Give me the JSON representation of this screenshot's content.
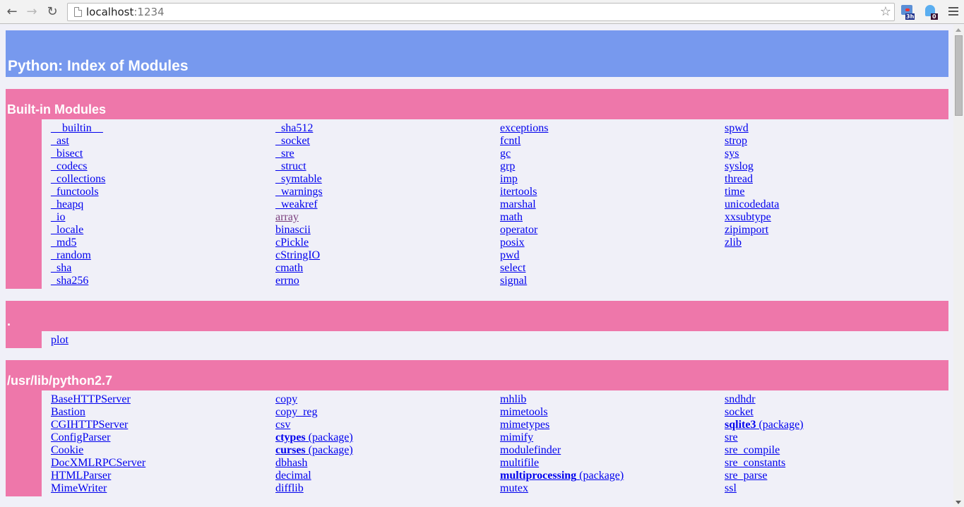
{
  "browser": {
    "url_host": "localhost",
    "url_port": ":1234",
    "extensions": [
      {
        "name": "calendar-extension",
        "badge": "3h"
      },
      {
        "name": "ghostery-extension",
        "badge": "0"
      }
    ]
  },
  "page": {
    "title": "Python: Index of Modules",
    "sections": [
      {
        "heading": "Built-in Modules",
        "columns": [
          [
            {
              "name": "__builtin__"
            },
            {
              "name": "_ast"
            },
            {
              "name": "_bisect"
            },
            {
              "name": "_codecs"
            },
            {
              "name": "_collections"
            },
            {
              "name": "_functools"
            },
            {
              "name": "_heapq"
            },
            {
              "name": "_io"
            },
            {
              "name": "_locale"
            },
            {
              "name": "_md5"
            },
            {
              "name": "_random"
            },
            {
              "name": "_sha"
            },
            {
              "name": "_sha256"
            }
          ],
          [
            {
              "name": "_sha512"
            },
            {
              "name": "_socket"
            },
            {
              "name": "_sre"
            },
            {
              "name": "_struct"
            },
            {
              "name": "_symtable"
            },
            {
              "name": "_warnings"
            },
            {
              "name": "_weakref"
            },
            {
              "name": "array",
              "visited": true
            },
            {
              "name": "binascii"
            },
            {
              "name": "cPickle"
            },
            {
              "name": "cStringIO"
            },
            {
              "name": "cmath"
            },
            {
              "name": "errno"
            }
          ],
          [
            {
              "name": "exceptions"
            },
            {
              "name": "fcntl"
            },
            {
              "name": "gc"
            },
            {
              "name": "grp"
            },
            {
              "name": "imp"
            },
            {
              "name": "itertools"
            },
            {
              "name": "marshal"
            },
            {
              "name": "math"
            },
            {
              "name": "operator"
            },
            {
              "name": "posix"
            },
            {
              "name": "pwd"
            },
            {
              "name": "select"
            },
            {
              "name": "signal"
            }
          ],
          [
            {
              "name": "spwd"
            },
            {
              "name": "strop"
            },
            {
              "name": "sys"
            },
            {
              "name": "syslog"
            },
            {
              "name": "thread"
            },
            {
              "name": "time"
            },
            {
              "name": "unicodedata"
            },
            {
              "name": "xxsubtype"
            },
            {
              "name": "zipimport"
            },
            {
              "name": "zlib"
            }
          ]
        ]
      },
      {
        "heading": ".",
        "columns": [
          [
            {
              "name": "plot"
            }
          ],
          [],
          [],
          []
        ]
      },
      {
        "heading": "/usr/lib/python2.7",
        "columns": [
          [
            {
              "name": "BaseHTTPServer"
            },
            {
              "name": "Bastion"
            },
            {
              "name": "CGIHTTPServer"
            },
            {
              "name": "ConfigParser"
            },
            {
              "name": "Cookie"
            },
            {
              "name": "DocXMLRPCServer"
            },
            {
              "name": "HTMLParser"
            },
            {
              "name": "MimeWriter"
            }
          ],
          [
            {
              "name": "copy"
            },
            {
              "name": "copy_reg"
            },
            {
              "name": "csv"
            },
            {
              "name": "ctypes",
              "package_label": " (package)"
            },
            {
              "name": "curses",
              "package_label": " (package)"
            },
            {
              "name": "dbhash"
            },
            {
              "name": "decimal"
            },
            {
              "name": "difflib"
            }
          ],
          [
            {
              "name": "mhlib"
            },
            {
              "name": "mimetools"
            },
            {
              "name": "mimetypes"
            },
            {
              "name": "mimify"
            },
            {
              "name": "modulefinder"
            },
            {
              "name": "multifile"
            },
            {
              "name": "multiprocessing",
              "package_label": " (package)"
            },
            {
              "name": "mutex"
            }
          ],
          [
            {
              "name": "sndhdr"
            },
            {
              "name": "socket"
            },
            {
              "name": "sqlite3",
              "package_label": " (package)"
            },
            {
              "name": "sre"
            },
            {
              "name": "sre_compile"
            },
            {
              "name": "sre_constants"
            },
            {
              "name": "sre_parse"
            },
            {
              "name": "ssl"
            }
          ]
        ]
      }
    ]
  },
  "colors": {
    "title_bg": "#7799ee",
    "section_bg": "#ee77aa",
    "page_bg": "#f0f0f8",
    "link": "#0000ee",
    "visited_link": "#7a3f7e"
  }
}
